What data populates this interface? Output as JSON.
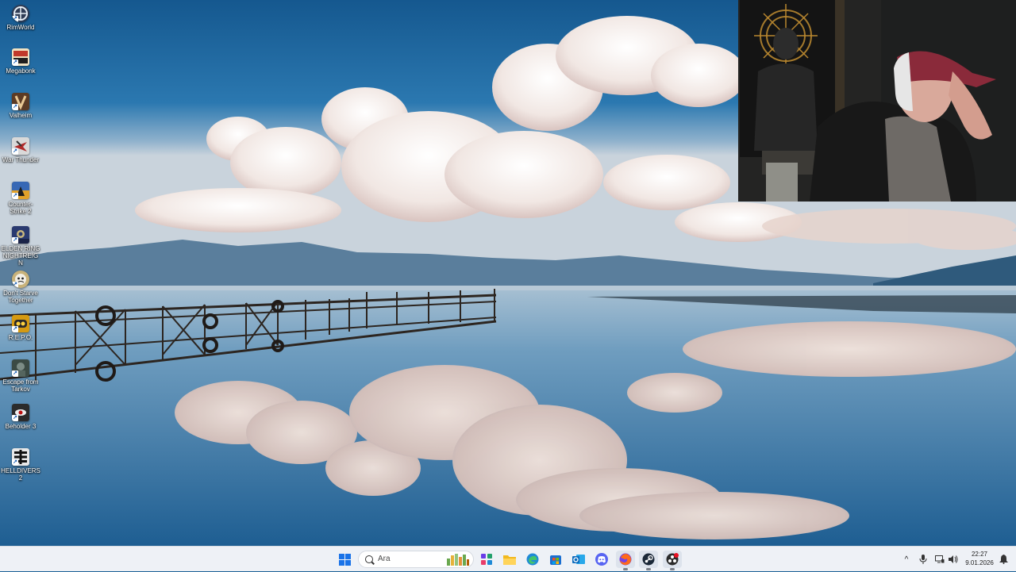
{
  "desktop": {
    "icons": [
      {
        "label": "RimWorld",
        "icon": "rimworld-icon",
        "color": "#2f3c55"
      },
      {
        "label": "Megabonk",
        "icon": "megabonk-icon",
        "color": "#c0392b"
      },
      {
        "label": "Valheim",
        "icon": "valheim-icon",
        "color": "#5b3b25"
      },
      {
        "label": "War Thunder",
        "icon": "war-thunder-icon",
        "color": "#d9d9d9"
      },
      {
        "label": "Counter-Strike 2",
        "icon": "counter-strike-icon",
        "color": "#e0a12a"
      },
      {
        "label": "ELDEN RING NIGHTREIGN",
        "icon": "elden-ring-icon",
        "color": "#2a3a70"
      },
      {
        "label": "Don't Starve Together",
        "icon": "dont-starve-icon",
        "color": "#c8b27a"
      },
      {
        "label": "R.E.P.O.",
        "icon": "repo-icon",
        "color": "#d59a12"
      },
      {
        "label": "Escape from Tarkov",
        "icon": "tarkov-icon",
        "color": "#3b4a44"
      },
      {
        "label": "Beholder 3",
        "icon": "beholder-icon",
        "color": "#2b2b2b"
      },
      {
        "label": "HELLDIVERS 2",
        "icon": "helldivers-icon",
        "color": "#e8e8e8"
      }
    ]
  },
  "taskbar": {
    "search_placeholder": "Ara",
    "apps": [
      {
        "name": "copilot-icon",
        "color": "#6a3de8"
      },
      {
        "name": "file-explorer-icon",
        "color": "#f2b91f"
      },
      {
        "name": "edge-icon",
        "color": "#1f8ad6"
      },
      {
        "name": "microsoft-store-icon",
        "color": "#1a6fd1"
      },
      {
        "name": "outlook-icon",
        "color": "#0f6cbd"
      },
      {
        "name": "discord-icon",
        "color": "#5865f2"
      },
      {
        "name": "firefox-icon",
        "color": "#ff6a1a"
      },
      {
        "name": "steam-icon",
        "color": "#1b2838"
      },
      {
        "name": "obs-icon",
        "color": "#2b2b2b"
      }
    ],
    "tray": {
      "chevron": "^",
      "time": "22:27",
      "date": "9.01.2026"
    }
  }
}
